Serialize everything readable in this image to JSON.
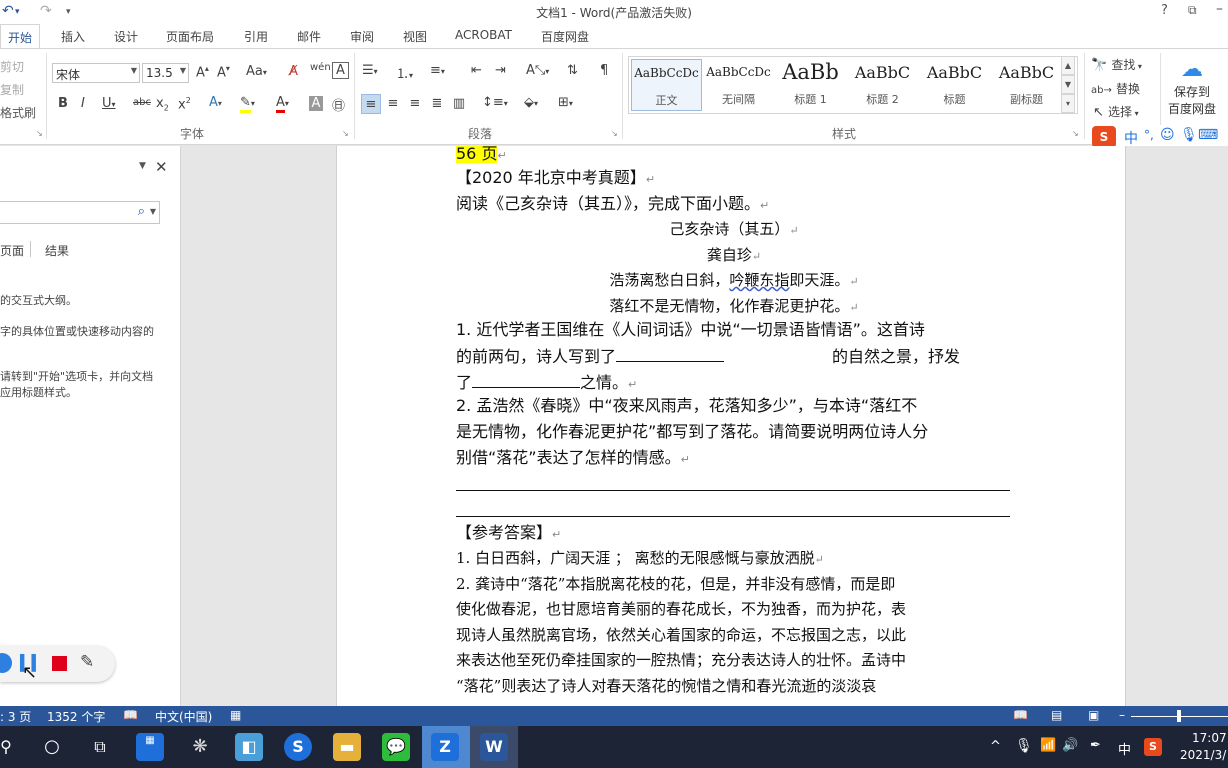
{
  "titlebar": {
    "title": "文档1 - Word(产品激活失败)",
    "help": "?",
    "undo_icon": "undo-icon",
    "redo_icon": "redo-icon"
  },
  "tabs": [
    "开始",
    "插入",
    "设计",
    "页面布局",
    "引用",
    "邮件",
    "审阅",
    "视图",
    "ACROBAT",
    "百度网盘"
  ],
  "ribbon": {
    "clipboard": {
      "cut": "剪切",
      "copy": "复制",
      "format_painter": "格式刷"
    },
    "font": {
      "name": "宋体",
      "size": "13.5",
      "group_label": "字体",
      "change_case": "Aa"
    },
    "paragraph": {
      "group_label": "段落"
    },
    "styles": {
      "group_label": "样式",
      "items": [
        {
          "preview": "AaBbCcDc",
          "name": "正文"
        },
        {
          "preview": "AaBbCcDc",
          "name": "无间隔"
        },
        {
          "preview": "AaBb",
          "name": "标题 1"
        },
        {
          "preview": "AaBbC",
          "name": "标题 2"
        },
        {
          "preview": "AaBbC",
          "name": "标题"
        },
        {
          "preview": "AaBbC",
          "name": "副标题"
        }
      ]
    },
    "editing": {
      "find": "查找",
      "replace": "替换",
      "select": "选择"
    },
    "baidu": {
      "save_line1": "保存到",
      "save_line2": "百度网盘"
    },
    "ime": {
      "mode": "中"
    }
  },
  "navpane": {
    "tabs": [
      "页面",
      "结果"
    ],
    "text1": "的交互式大纲。",
    "text2": "字的具体位置或快速移动内容的",
    "text3": "请转到\"开始\"选项卡，并向文档",
    "text4": "应用标题样式。"
  },
  "document": {
    "page_ref": "56 页",
    "heading": "【2020 年北京中考真题】",
    "intro": "阅读《己亥杂诗（其五）》，完成下面小题。",
    "poem_title": "己亥杂诗（其五）",
    "poem_author": "龚自珍",
    "poem_line1_a": "浩荡离愁白日斜，",
    "poem_line1_b": "吟鞭东指",
    "poem_line1_c": "即天涯。",
    "poem_line2": "落红不是无情物，化作春泥更护花。",
    "q1_line1": "1. 近代学者王国维在《人间词话》中说“一切景语皆情语”。这首诗",
    "q1_line2a": "的前两句，诗人写到了",
    "q1_line2b": "的自然之景，抒发",
    "q1_line3a": "了",
    "q1_line3b": "之情。",
    "q2_line1": "2. 孟浩然《春晓》中“夜来风雨声，花落知多少”，与本诗“落红不",
    "q2_line2": "是无情物，化作春泥更护花”都写到了落花。请简要说明两位诗人分",
    "q2_line3": "别借“落花”表达了怎样的情感。",
    "answer_heading": "【参考答案】",
    "a1": "1. 白日西斜，广阔天涯 ； 离愁的无限感慨与豪放洒脱",
    "a2_l1": "2. 龚诗中“落花”本指脱离花枝的花，但是，并非没有感情，而是即",
    "a2_l2": "使化做春泥，也甘愿培育美丽的春花成长，不为独香，而为护花，表",
    "a2_l3": "现诗人虽然脱离官场，依然关心着国家的命运，不忘报国之志，以此",
    "a2_l4": "来表达他至死仍牵挂国家的一腔热情；充分表达诗人的壮怀。孟诗中",
    "a2_l5": "“落花”则表达了诗人对春天落花的惋惜之情和春光流逝的淡淡哀"
  },
  "statusbar": {
    "pages": "3 页",
    "words": "1352 个字",
    "language": "中文(中国)"
  },
  "taskbar": {
    "time": "17:07",
    "date": "2021/3/",
    "ime": "中"
  },
  "colors": {
    "accent": "#2b579a",
    "highlight": "#ffff00",
    "taskbar": "#1c2436"
  }
}
